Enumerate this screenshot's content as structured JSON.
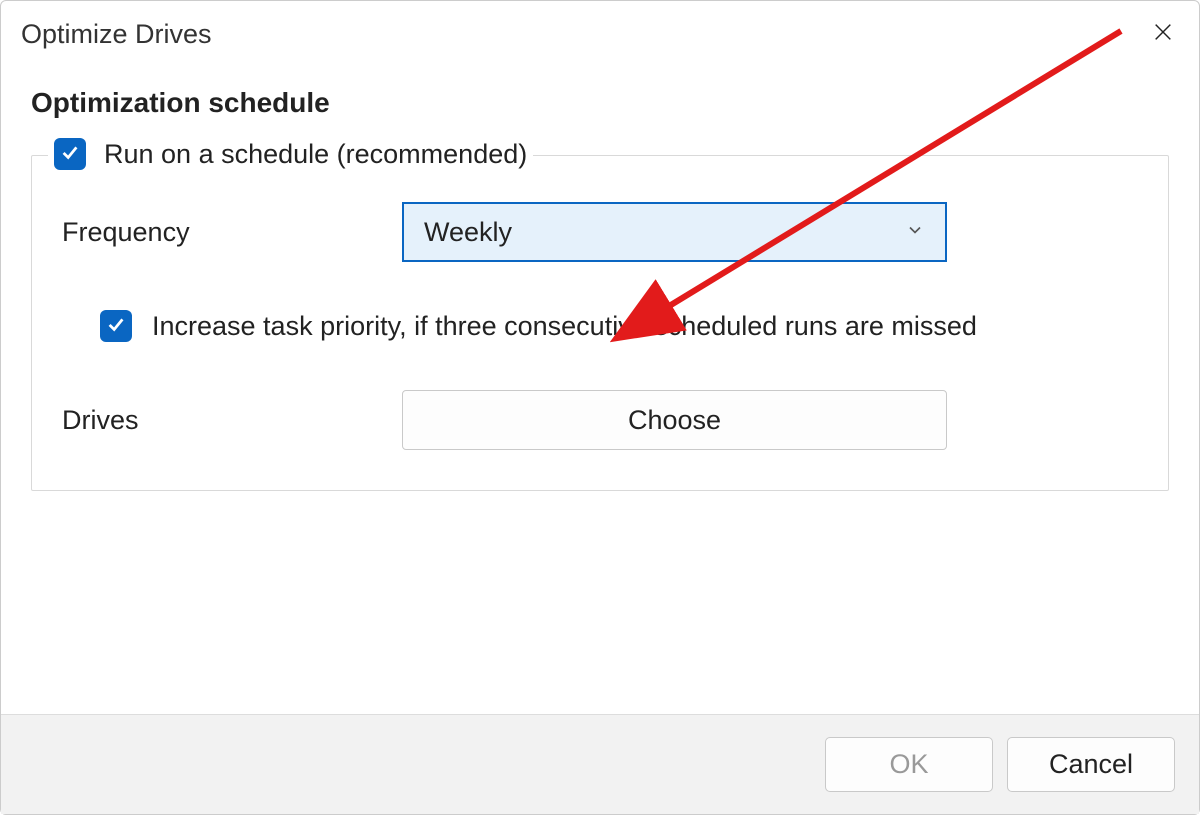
{
  "window": {
    "title": "Optimize Drives"
  },
  "heading": "Optimization schedule",
  "schedule": {
    "run_on_schedule_label": "Run on a schedule (recommended)",
    "run_on_schedule_checked": true,
    "frequency_label": "Frequency",
    "frequency_value": "Weekly",
    "increase_priority_label": "Increase task priority, if three consecutive scheduled runs are missed",
    "increase_priority_checked": true,
    "drives_label": "Drives",
    "choose_label": "Choose"
  },
  "footer": {
    "ok_label": "OK",
    "cancel_label": "Cancel"
  },
  "annotation": {
    "arrow_color": "#e21b1b"
  }
}
